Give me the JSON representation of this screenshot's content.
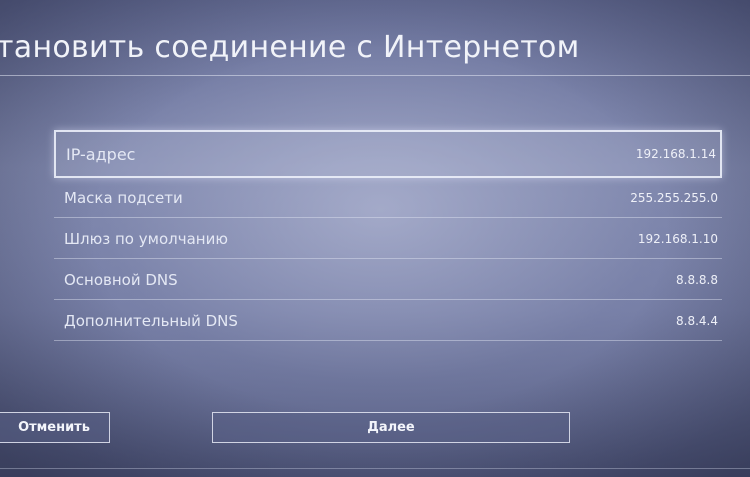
{
  "title": "тановить соединение с Интернетом",
  "settings": [
    {
      "label": "IP-адрес",
      "value": "192.168.1.14"
    },
    {
      "label": "Маска подсети",
      "value": "255.255.255.0"
    },
    {
      "label": "Шлюз по умолчанию",
      "value": "192.168.1.10"
    },
    {
      "label": "Основной DNS",
      "value": "8.8.8.8"
    },
    {
      "label": "Дополнительный DNS",
      "value": "8.8.4.4"
    }
  ],
  "buttons": {
    "cancel": "Отменить",
    "next": "Далее"
  }
}
